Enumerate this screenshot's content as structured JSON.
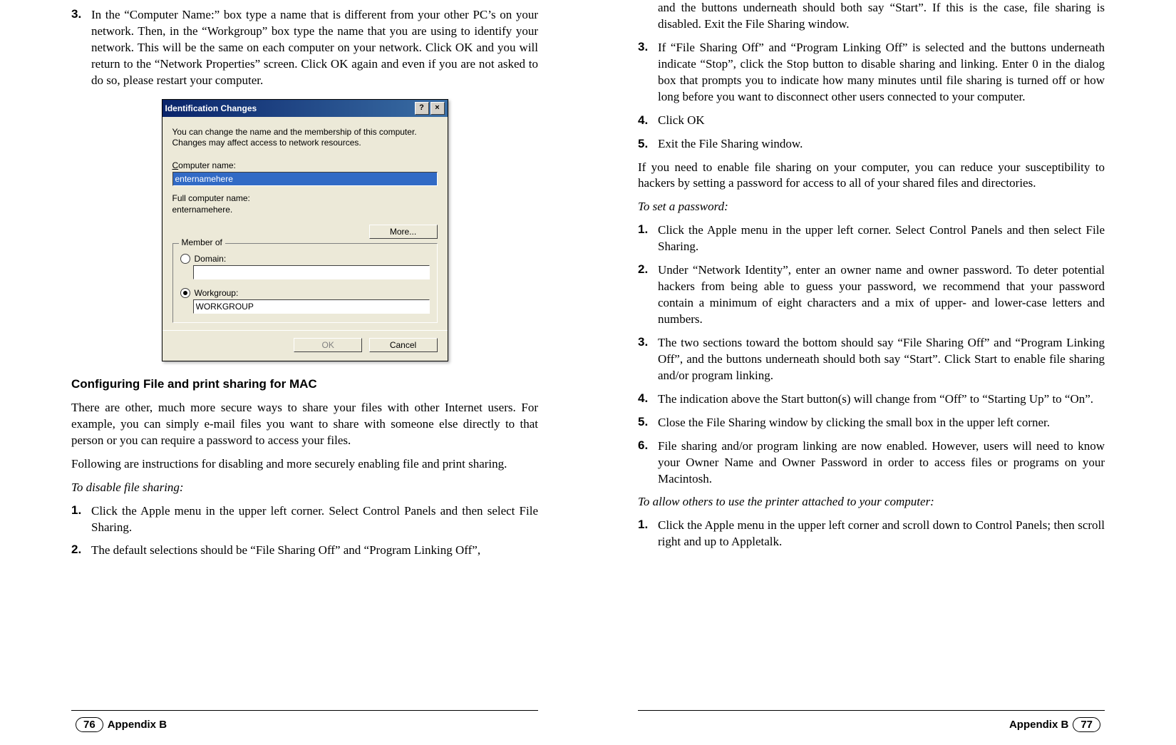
{
  "left": {
    "step3_num": "3.",
    "step3_body": "In the “Computer Name:” box type a name that is different from your other PC’s on your network. Then, in the “Workgroup” box type the name that you are using to identify your network. This will be the same on each computer on your network. Click OK and you will return to the “Network Properties” screen. Click OK again and even if you are not asked to do so, please restart your computer.",
    "dialog": {
      "title": "Identification Changes",
      "help_btn": "?",
      "close_btn": "×",
      "intro": "You can change the name and the membership of this computer. Changes may affect access to network resources.",
      "label_computer_name": "Computer name:",
      "computer_name_value": "enternamehere",
      "label_full_name": "Full computer name:",
      "full_name_value": "enternamehere.",
      "more_btn": "More...",
      "member_of_legend": "Member of",
      "domain_label": "Domain:",
      "workgroup_label": "Workgroup:",
      "workgroup_value": "WORKGROUP",
      "ok_btn": "OK",
      "cancel_btn": "Cancel"
    },
    "mac_heading": "Configuring File and print sharing for MAC",
    "mac_p1": "There are other, much more secure ways to share your files with other Internet users. For example, you can simply e-mail files you want to share with someone else directly to that person or you can require a password to access your files.",
    "mac_p2": "Following are instructions for disabling and more securely enabling file and print sharing.",
    "disable_label": "To disable file sharing:",
    "d1_num": "1.",
    "d1_body": "Click the Apple menu in the upper left corner. Select Control Panels and then select File Sharing.",
    "d2_num": "2.",
    "d2_body": "The default selections should be “File Sharing Off” and “Program Linking Off”,",
    "footer_pagenum": "76",
    "footer_label": "Appendix B"
  },
  "right": {
    "cont_body": "and the buttons underneath should both say “Start”. If this is the case, file sharing is disabled. Exit the File Sharing window.",
    "r3_num": "3.",
    "r3_body": "If “File Sharing Off” and “Program Linking Off” is selected and the buttons underneath indicate “Stop”, click the Stop button to disable sharing and linking. Enter 0 in the dialog box that prompts you to indicate how many minutes until file sharing is turned off or how long before you want to disconnect other users connected to your computer.",
    "r4_num": "4.",
    "r4_body": "Click OK",
    "r5_num": "5.",
    "r5_body": "Exit the File Sharing window.",
    "after_p": "If you need to enable file sharing on your computer, you can reduce your susceptibility to hackers by setting a password for access to all of your shared files and directories.",
    "set_pw_label": "To set a password:",
    "p1_num": "1.",
    "p1_body": "Click the Apple menu in the upper left corner. Select Control Panels and then select File Sharing.",
    "p2_num": "2.",
    "p2_body": "Under “Network Identity”, enter an owner name and owner password. To deter potential hackers from being able to guess your password, we recommend that your password contain a minimum of eight characters and a mix of upper- and lower-case letters and numbers.",
    "p3_num": "3.",
    "p3_body": "The two sections toward the bottom should say “File Sharing Off” and “Program Linking Off”, and the buttons underneath should both say “Start”. Click Start to enable file sharing and/or program linking.",
    "p4_num": "4.",
    "p4_body": "The indication above the Start button(s) will change from “Off” to “Starting Up” to “On”.",
    "p5_num": "5.",
    "p5_body": "Close the File Sharing window by clicking the small box in the upper left corner.",
    "p6_num": "6.",
    "p6_body": "File sharing and/or program linking are now enabled. However, users will need to know your Owner Name and Owner Password in order to access files or programs on your Macintosh.",
    "printer_label": "To allow others to use the printer attached to your computer:",
    "pr1_num": "1.",
    "pr1_body": "Click the Apple menu in the upper left corner and scroll down to Control Panels; then scroll right and up to Appletalk.",
    "footer_label": "Appendix B",
    "footer_pagenum": "77"
  }
}
